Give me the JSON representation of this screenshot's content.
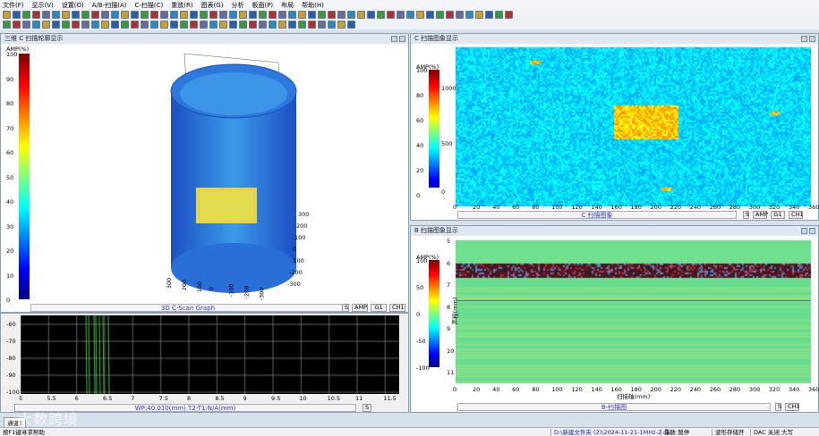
{
  "menu": [
    "文件(F)",
    "显示(V)",
    "设置(O)",
    "A/B-扫描(A)",
    "C-扫描(C)",
    "重放(R)",
    "图表(G)",
    "分析",
    "板面(P)",
    "布局",
    "帮助(H)"
  ],
  "panels": {
    "view3d": {
      "title": "三维 C 扫描轮廓显示",
      "colorbar_label": "AMP(%)",
      "colorbar_ticks": [
        "100",
        "90",
        "80",
        "70",
        "60",
        "50",
        "40",
        "30",
        "20",
        "10",
        "0"
      ],
      "footer": "3D C-Scan Graph",
      "axis_ticks_right": [
        "300",
        "200",
        "100",
        "0",
        "-100",
        "-200",
        "-300"
      ],
      "axis_ticks_bottom": [
        "300",
        "200",
        "100",
        "0",
        "-100",
        "-200",
        "-300"
      ],
      "buttons": [
        "S",
        "AMP",
        "G1",
        "CH1"
      ]
    },
    "ascan": {
      "y_ticks": [
        "-60",
        "-70",
        "-80",
        "-90",
        "-100"
      ],
      "x_ticks": [
        "5",
        "5.5",
        "6",
        "6.5",
        "7",
        "7.5",
        "8",
        "8.5",
        "9",
        "9.5",
        "10",
        "10.5",
        "11",
        "11.5"
      ],
      "footer": "WP:40.010(mm)  T2-T1:N/A(mm)",
      "buttons": [
        "S"
      ]
    },
    "cscan": {
      "title": "C 扫描图象显示",
      "colorbar_label": "AMP(%)",
      "colorbar_ticks": [
        "100",
        "80",
        "60",
        "40",
        "20",
        "0"
      ],
      "y_ticks": [
        "1000",
        "500",
        "0"
      ],
      "x_ticks": [
        "0",
        "20",
        "40",
        "60",
        "80",
        "100",
        "120",
        "140",
        "160",
        "180",
        "200",
        "220",
        "240",
        "260",
        "280",
        "300",
        "320",
        "340",
        "360"
      ],
      "footer": "C 扫描图象",
      "buttons": [
        "S",
        "AMP",
        "G1",
        "CH1"
      ]
    },
    "bscan": {
      "title": "B 扫描图象显示",
      "colorbar_label": "AMP(%)",
      "colorbar_ticks": [
        "100",
        "50",
        "0",
        "-50",
        "-100"
      ],
      "y_label": "声程(mm)",
      "y_ticks": [
        "5",
        "6",
        "7",
        "8",
        "9",
        "10",
        "11"
      ],
      "x_label": "扫描轴(mm)",
      "x_ticks": [
        "0",
        "20",
        "40",
        "60",
        "80",
        "100",
        "120",
        "140",
        "160",
        "180",
        "200",
        "220",
        "240",
        "260",
        "280",
        "300",
        "320",
        "340",
        "360"
      ],
      "footer": "B-扫描图",
      "buttons": [
        "S",
        "CH1"
      ]
    }
  },
  "tab": "通道1",
  "status": {
    "help": "按F1键寻求帮助",
    "file": "D:\\新建文件夹 (2)\\2024-11-21-1MHz-2.csc",
    "replay": "重放:暂停",
    "wave": "波形存储开",
    "dac": "DAC 关闭",
    "size": "大写"
  },
  "watermark": "大数跨境"
}
